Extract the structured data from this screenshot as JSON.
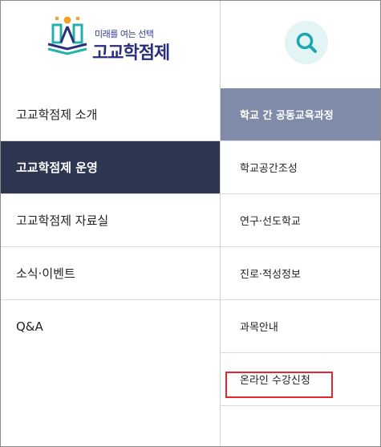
{
  "logo": {
    "tagline": "미래를 여는 선택",
    "brand": "고교학점제"
  },
  "search": {
    "icon": "search-icon"
  },
  "colors": {
    "primary_dark": "#2e3752",
    "secondary": "#7f8ba8",
    "highlight": "#e8262c",
    "search_bg": "#e3f4f4",
    "search_icon": "#1aa7b0"
  },
  "left_menu": {
    "items": [
      {
        "label": "고교학점제 소개",
        "active": false
      },
      {
        "label": "고교학점제 운영",
        "active": true
      },
      {
        "label": "고교학점제 자료실",
        "active": false
      },
      {
        "label": "소식·이벤트",
        "active": false
      },
      {
        "label": "Q&A",
        "active": false
      }
    ]
  },
  "right_menu": {
    "items": [
      {
        "label": "학교 간 공동교육과정",
        "active": true
      },
      {
        "label": "학교공간조성",
        "active": false
      },
      {
        "label": "연구·선도학교",
        "active": false
      },
      {
        "label": "진로·적성정보",
        "active": false
      },
      {
        "label": "과목안내",
        "active": false
      },
      {
        "label": "온라인 수강신청",
        "active": false,
        "highlighted": true
      }
    ]
  }
}
